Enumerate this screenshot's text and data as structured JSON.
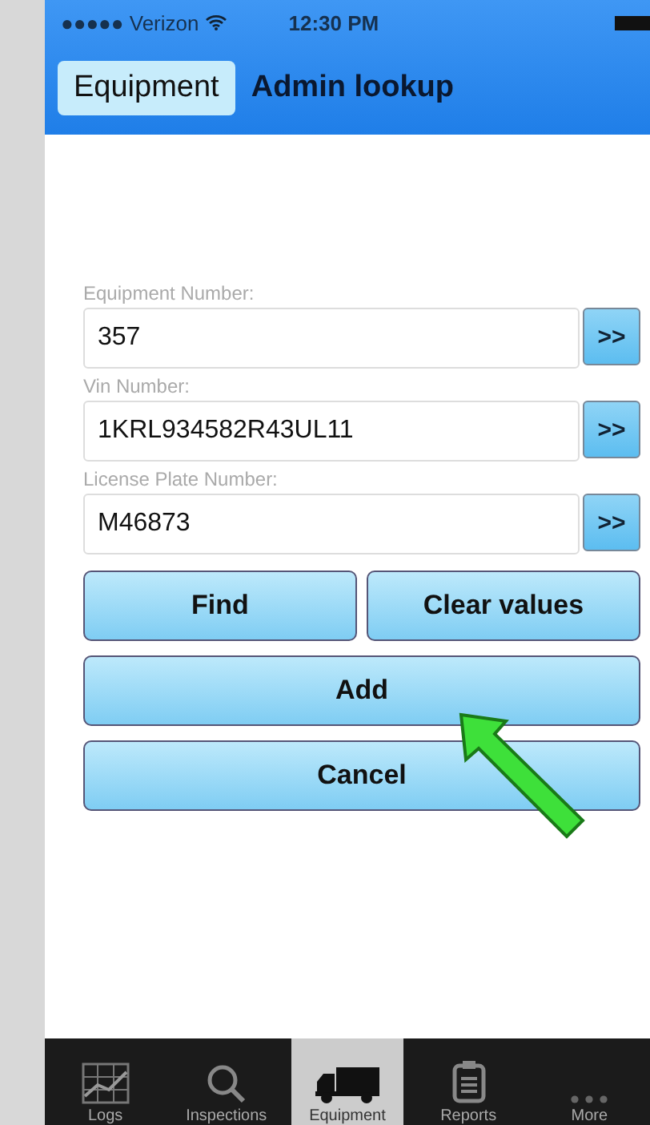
{
  "status_bar": {
    "carrier": "●●●●● Verizon",
    "time": "12:30 PM"
  },
  "nav": {
    "back": "Equipment",
    "title": "Admin lookup"
  },
  "fields": [
    {
      "label": "Equipment Number:",
      "value": "357",
      "action": ">>"
    },
    {
      "label": "Vin Number:",
      "value": "1KRL934582R43UL11",
      "action": ">>"
    },
    {
      "label": "License Plate Number:",
      "value": "M46873",
      "action": ">>"
    }
  ],
  "buttons": [
    {
      "label": "Find",
      "kind": "half"
    },
    {
      "label": "Clear values",
      "kind": "half"
    },
    {
      "label": "Add",
      "kind": "full"
    },
    {
      "label": "Cancel",
      "kind": "full"
    }
  ],
  "tabs": [
    {
      "label": "Logs",
      "kind": "chart",
      "selected": false
    },
    {
      "label": "Inspections",
      "kind": "search",
      "selected": false
    },
    {
      "label": "Equipment",
      "kind": "truck",
      "selected": true
    },
    {
      "label": "Reports",
      "kind": "clipboard",
      "selected": false
    },
    {
      "label": "More",
      "kind": "more",
      "selected": false
    }
  ]
}
